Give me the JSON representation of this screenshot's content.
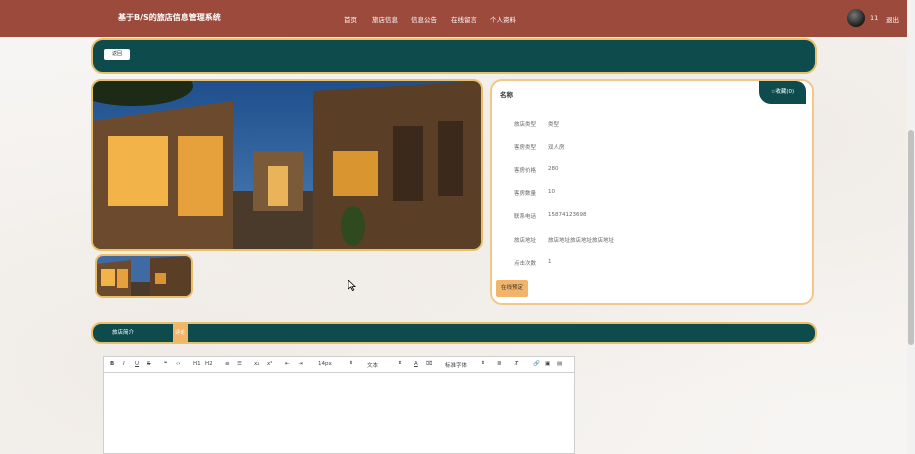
{
  "header": {
    "site_title": "基于B/S的旅店信息管理系统",
    "nav": [
      "首页",
      "旅店信息",
      "信息公告",
      "在线留言",
      "个人资料"
    ],
    "username": "11",
    "logout": "退出"
  },
  "breadcrumb": {
    "back_label": "返回"
  },
  "detail": {
    "name": "名称",
    "favorite_label": "收藏(0)",
    "fields": [
      {
        "label": "旅店类型",
        "value": "类型"
      },
      {
        "label": "客房类型",
        "value": "双人房"
      },
      {
        "label": "客房价格",
        "value": "280"
      },
      {
        "label": "客房数量",
        "value": "10"
      },
      {
        "label": "联系电话",
        "value": "15874123698"
      },
      {
        "label": "旅店地址",
        "value": "旅店地址旅店地址旅店地址"
      },
      {
        "label": "点击次数",
        "value": "1"
      }
    ],
    "book_label": "在线预定"
  },
  "tabs": {
    "intro": "旅店简介",
    "comments": "评论"
  },
  "editor": {
    "font_size": "14px",
    "heading": "文本",
    "font_family": "标准字体",
    "buttons": [
      "B",
      "I",
      "U",
      "S",
      "❝",
      "‹›",
      "H1",
      "H2",
      "≡",
      "☰",
      "x₂",
      "x²",
      "⇤",
      "⇥"
    ],
    "right_icons": [
      "A",
      "⌧",
      "≣",
      "T̸",
      "🔗",
      "▣",
      "▤"
    ]
  },
  "colors": {
    "header": "#9b4a3c",
    "teal": "#0d4b4d",
    "gold": "#e9c06a",
    "orange": "#f1b56a"
  }
}
